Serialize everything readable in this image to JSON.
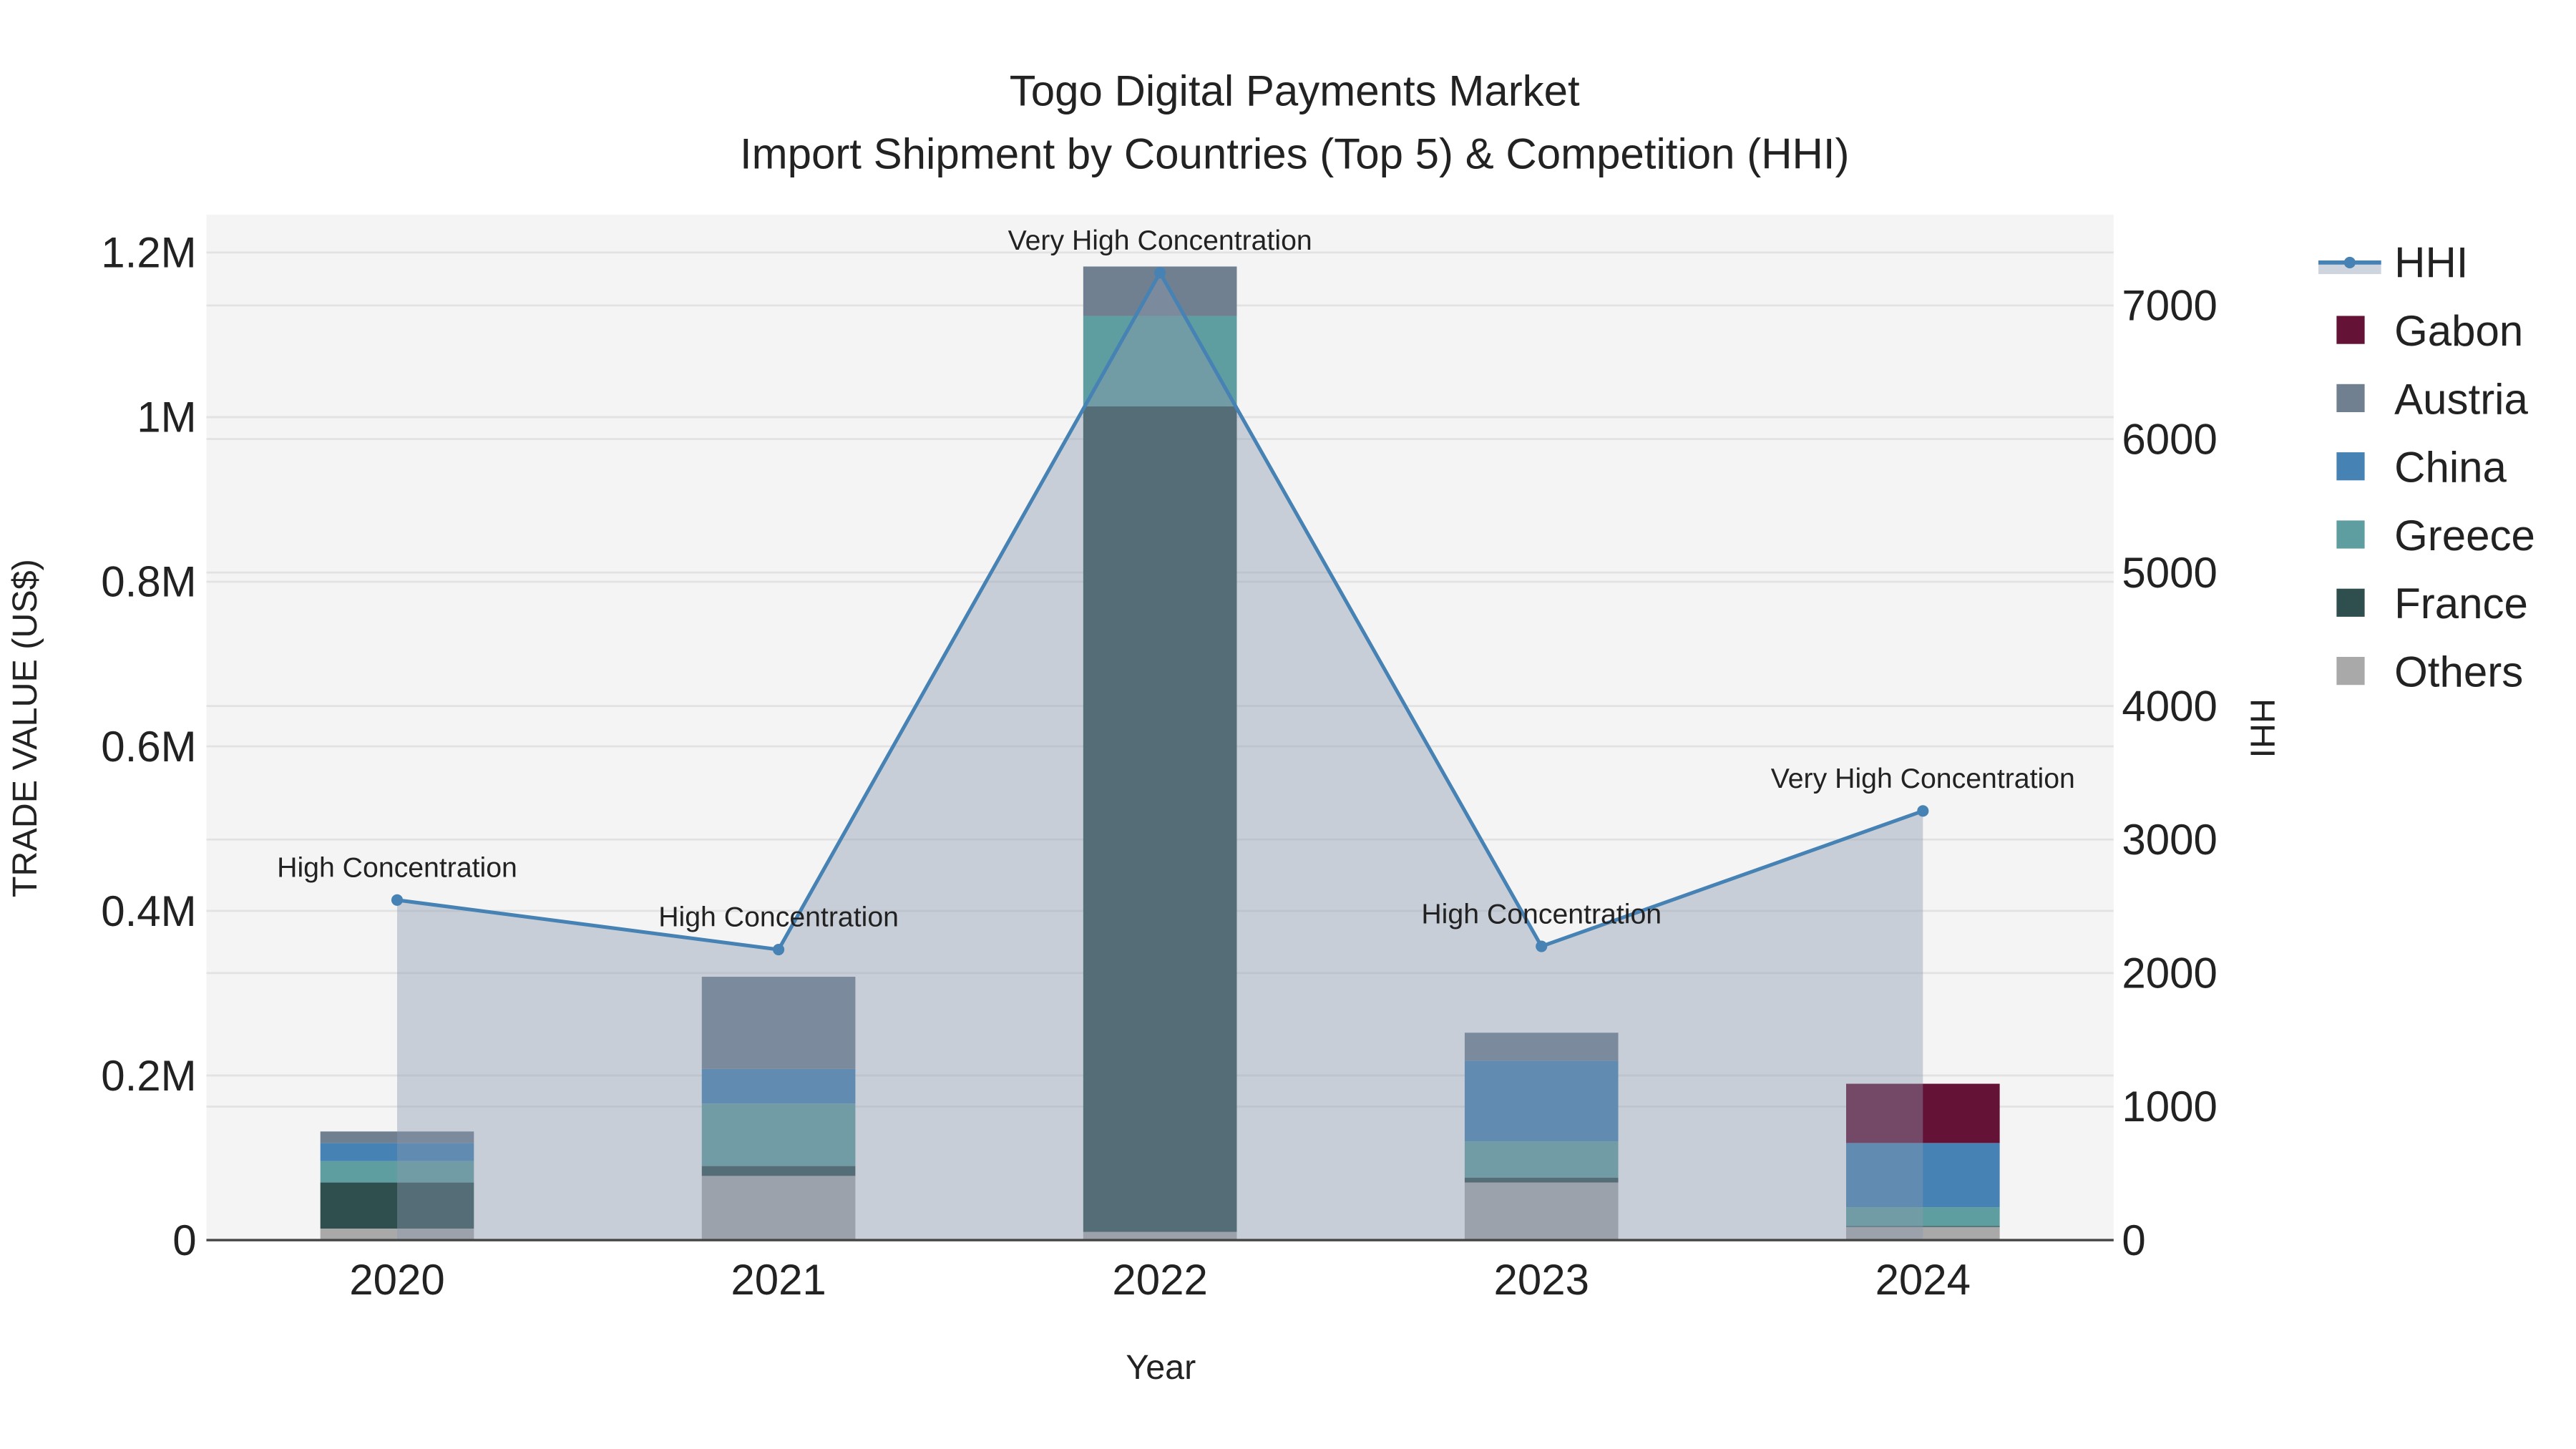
{
  "chart_data": {
    "type": "bar",
    "title": "Togo Digital Payments Market",
    "subtitle": "Import Shipment by Countries (Top 5) & Competition (HHI)",
    "xlabel": "Year",
    "ylabel": "TRADE VALUE (US$)",
    "y2label": "HHI",
    "categories": [
      "2020",
      "2021",
      "2022",
      "2023",
      "2024"
    ],
    "ylim": [
      0,
      1246000
    ],
    "y2lim": [
      0,
      7680
    ],
    "yticks": [
      0,
      200000,
      400000,
      600000,
      800000,
      1000000,
      1200000
    ],
    "ytick_labels": [
      "0",
      "0.2M",
      "0.4M",
      "0.6M",
      "0.8M",
      "1M",
      "1.2M"
    ],
    "y2ticks": [
      0,
      1000,
      2000,
      3000,
      4000,
      5000,
      6000,
      7000
    ],
    "y2tick_labels": [
      "0",
      "1000",
      "2000",
      "3000",
      "4000",
      "5000",
      "6000",
      "7000"
    ],
    "grid": true,
    "legend_position": "right",
    "stacked": true,
    "series": [
      {
        "name": "Others",
        "color": "#a9a9a9",
        "values": [
          14000,
          78000,
          10000,
          70000,
          16000
        ]
      },
      {
        "name": "France",
        "color": "#2f4f4f",
        "values": [
          56000,
          12000,
          1003000,
          6000,
          1000
        ]
      },
      {
        "name": "Greece",
        "color": "#5f9ea0",
        "values": [
          26000,
          76000,
          110000,
          44000,
          23000
        ]
      },
      {
        "name": "China",
        "color": "#4682b4",
        "values": [
          22000,
          42000,
          0,
          98000,
          78000
        ]
      },
      {
        "name": "Austria",
        "color": "#708090",
        "values": [
          14000,
          112000,
          60000,
          34000,
          0
        ]
      },
      {
        "name": "Gabon",
        "color": "#641236",
        "values": [
          0,
          0,
          0,
          0,
          72000
        ]
      }
    ],
    "hhi": {
      "name": "HHI",
      "color": "#4682b4",
      "values": [
        2547,
        2176,
        7245,
        2200,
        3214
      ],
      "annotations": [
        "High Concentration",
        "High Concentration",
        "Very High Concentration",
        "High Concentration",
        "Very High Concentration"
      ]
    },
    "legend_order": [
      "HHI",
      "Gabon",
      "Austria",
      "China",
      "Greece",
      "France",
      "Others"
    ]
  }
}
